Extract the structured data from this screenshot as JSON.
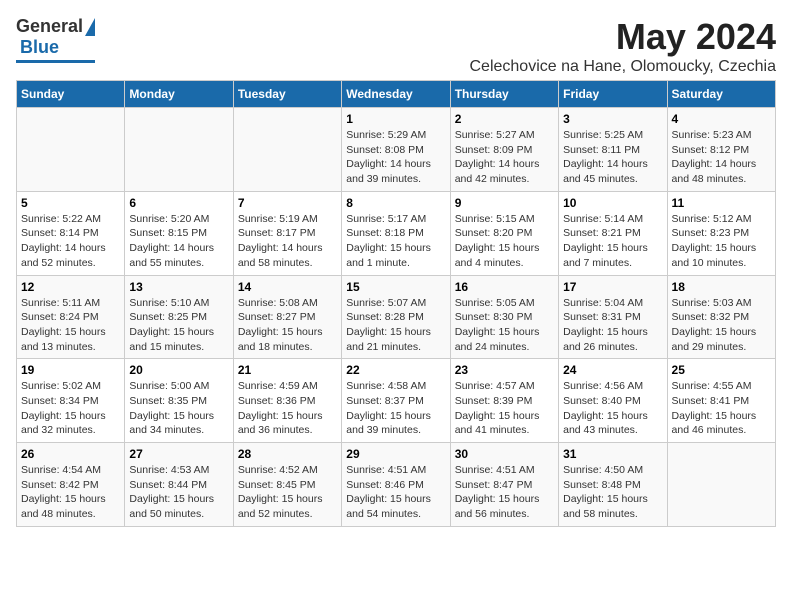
{
  "header": {
    "logo_general": "General",
    "logo_blue": "Blue",
    "month_title": "May 2024",
    "subtitle": "Celechovice na Hane, Olomoucky, Czechia"
  },
  "calendar": {
    "days_of_week": [
      "Sunday",
      "Monday",
      "Tuesday",
      "Wednesday",
      "Thursday",
      "Friday",
      "Saturday"
    ],
    "weeks": [
      [
        {
          "day": "",
          "info": ""
        },
        {
          "day": "",
          "info": ""
        },
        {
          "day": "",
          "info": ""
        },
        {
          "day": "1",
          "info": "Sunrise: 5:29 AM\nSunset: 8:08 PM\nDaylight: 14 hours\nand 39 minutes."
        },
        {
          "day": "2",
          "info": "Sunrise: 5:27 AM\nSunset: 8:09 PM\nDaylight: 14 hours\nand 42 minutes."
        },
        {
          "day": "3",
          "info": "Sunrise: 5:25 AM\nSunset: 8:11 PM\nDaylight: 14 hours\nand 45 minutes."
        },
        {
          "day": "4",
          "info": "Sunrise: 5:23 AM\nSunset: 8:12 PM\nDaylight: 14 hours\nand 48 minutes."
        }
      ],
      [
        {
          "day": "5",
          "info": "Sunrise: 5:22 AM\nSunset: 8:14 PM\nDaylight: 14 hours\nand 52 minutes."
        },
        {
          "day": "6",
          "info": "Sunrise: 5:20 AM\nSunset: 8:15 PM\nDaylight: 14 hours\nand 55 minutes."
        },
        {
          "day": "7",
          "info": "Sunrise: 5:19 AM\nSunset: 8:17 PM\nDaylight: 14 hours\nand 58 minutes."
        },
        {
          "day": "8",
          "info": "Sunrise: 5:17 AM\nSunset: 8:18 PM\nDaylight: 15 hours\nand 1 minute."
        },
        {
          "day": "9",
          "info": "Sunrise: 5:15 AM\nSunset: 8:20 PM\nDaylight: 15 hours\nand 4 minutes."
        },
        {
          "day": "10",
          "info": "Sunrise: 5:14 AM\nSunset: 8:21 PM\nDaylight: 15 hours\nand 7 minutes."
        },
        {
          "day": "11",
          "info": "Sunrise: 5:12 AM\nSunset: 8:23 PM\nDaylight: 15 hours\nand 10 minutes."
        }
      ],
      [
        {
          "day": "12",
          "info": "Sunrise: 5:11 AM\nSunset: 8:24 PM\nDaylight: 15 hours\nand 13 minutes."
        },
        {
          "day": "13",
          "info": "Sunrise: 5:10 AM\nSunset: 8:25 PM\nDaylight: 15 hours\nand 15 minutes."
        },
        {
          "day": "14",
          "info": "Sunrise: 5:08 AM\nSunset: 8:27 PM\nDaylight: 15 hours\nand 18 minutes."
        },
        {
          "day": "15",
          "info": "Sunrise: 5:07 AM\nSunset: 8:28 PM\nDaylight: 15 hours\nand 21 minutes."
        },
        {
          "day": "16",
          "info": "Sunrise: 5:05 AM\nSunset: 8:30 PM\nDaylight: 15 hours\nand 24 minutes."
        },
        {
          "day": "17",
          "info": "Sunrise: 5:04 AM\nSunset: 8:31 PM\nDaylight: 15 hours\nand 26 minutes."
        },
        {
          "day": "18",
          "info": "Sunrise: 5:03 AM\nSunset: 8:32 PM\nDaylight: 15 hours\nand 29 minutes."
        }
      ],
      [
        {
          "day": "19",
          "info": "Sunrise: 5:02 AM\nSunset: 8:34 PM\nDaylight: 15 hours\nand 32 minutes."
        },
        {
          "day": "20",
          "info": "Sunrise: 5:00 AM\nSunset: 8:35 PM\nDaylight: 15 hours\nand 34 minutes."
        },
        {
          "day": "21",
          "info": "Sunrise: 4:59 AM\nSunset: 8:36 PM\nDaylight: 15 hours\nand 36 minutes."
        },
        {
          "day": "22",
          "info": "Sunrise: 4:58 AM\nSunset: 8:37 PM\nDaylight: 15 hours\nand 39 minutes."
        },
        {
          "day": "23",
          "info": "Sunrise: 4:57 AM\nSunset: 8:39 PM\nDaylight: 15 hours\nand 41 minutes."
        },
        {
          "day": "24",
          "info": "Sunrise: 4:56 AM\nSunset: 8:40 PM\nDaylight: 15 hours\nand 43 minutes."
        },
        {
          "day": "25",
          "info": "Sunrise: 4:55 AM\nSunset: 8:41 PM\nDaylight: 15 hours\nand 46 minutes."
        }
      ],
      [
        {
          "day": "26",
          "info": "Sunrise: 4:54 AM\nSunset: 8:42 PM\nDaylight: 15 hours\nand 48 minutes."
        },
        {
          "day": "27",
          "info": "Sunrise: 4:53 AM\nSunset: 8:44 PM\nDaylight: 15 hours\nand 50 minutes."
        },
        {
          "day": "28",
          "info": "Sunrise: 4:52 AM\nSunset: 8:45 PM\nDaylight: 15 hours\nand 52 minutes."
        },
        {
          "day": "29",
          "info": "Sunrise: 4:51 AM\nSunset: 8:46 PM\nDaylight: 15 hours\nand 54 minutes."
        },
        {
          "day": "30",
          "info": "Sunrise: 4:51 AM\nSunset: 8:47 PM\nDaylight: 15 hours\nand 56 minutes."
        },
        {
          "day": "31",
          "info": "Sunrise: 4:50 AM\nSunset: 8:48 PM\nDaylight: 15 hours\nand 58 minutes."
        },
        {
          "day": "",
          "info": ""
        }
      ]
    ]
  }
}
